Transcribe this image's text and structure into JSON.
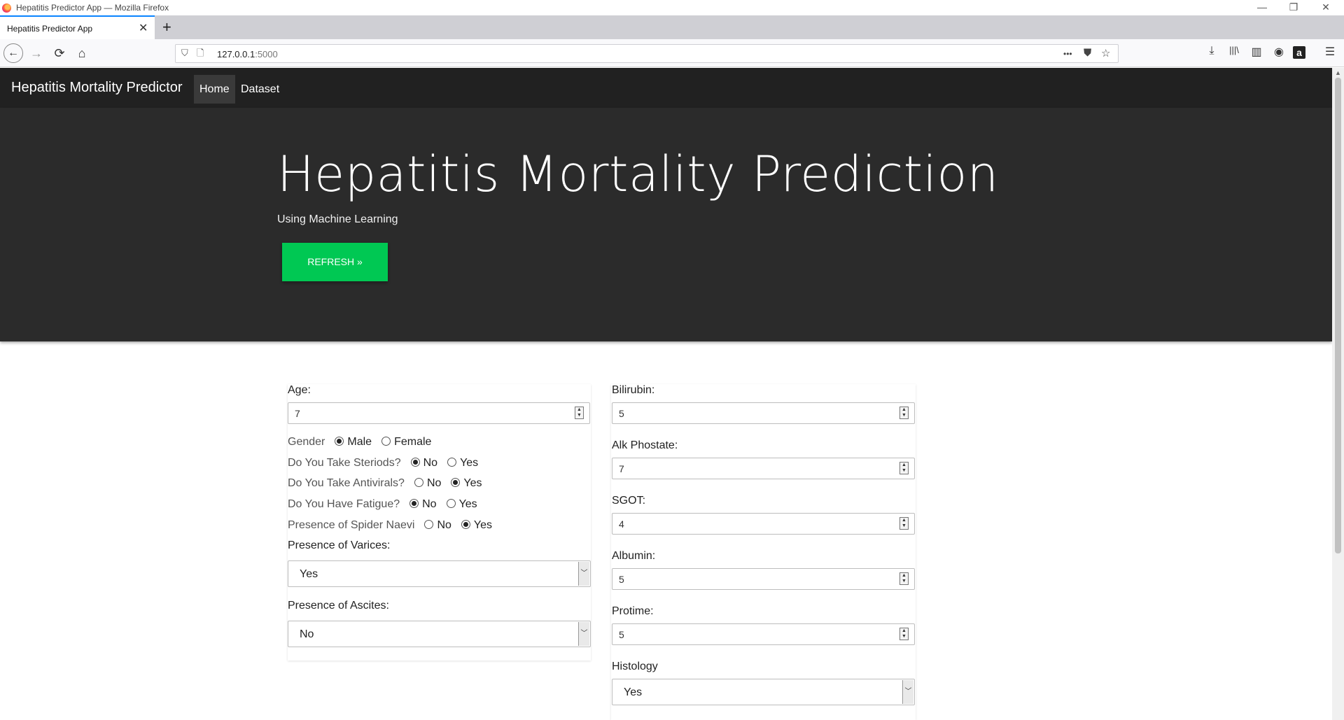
{
  "window": {
    "title": "Hepatitis Predictor App — Mozilla Firefox"
  },
  "tabs": [
    {
      "label": "Hepatitis Predictor App"
    }
  ],
  "address_bar": {
    "host": "127.0.0.1",
    "port": ":5000"
  },
  "site_nav": {
    "brand": "Hepatitis Mortality Predictor",
    "links": [
      {
        "label": "Home",
        "active": true
      },
      {
        "label": "Dataset",
        "active": false
      }
    ]
  },
  "hero": {
    "title": "Hepatitis Mortality Prediction",
    "subtitle": "Using Machine Learning",
    "button_label": "REFRESH »"
  },
  "form_left": {
    "age_label": "Age:",
    "age_value": "7",
    "gender": {
      "question": "Gender",
      "options": [
        "Male",
        "Female"
      ],
      "selected": "Male"
    },
    "steroids": {
      "question": "Do You Take Steriods?",
      "options": [
        "No",
        "Yes"
      ],
      "selected": "No"
    },
    "antivirals": {
      "question": "Do You Take Antivirals?",
      "options": [
        "No",
        "Yes"
      ],
      "selected": "Yes"
    },
    "fatigue": {
      "question": "Do You Have Fatigue?",
      "options": [
        "No",
        "Yes"
      ],
      "selected": "No"
    },
    "spider_naevi": {
      "question": "Presence of Spider Naevi",
      "options": [
        "No",
        "Yes"
      ],
      "selected": "Yes"
    },
    "varices_label": "Presence of Varices:",
    "varices_value": "Yes",
    "ascites_label": "Presence of Ascites:",
    "ascites_value": "No"
  },
  "form_right": {
    "bilirubin_label": "Bilirubin:",
    "bilirubin_value": "5",
    "alk_label": "Alk Phostate:",
    "alk_value": "7",
    "sgot_label": "SGOT:",
    "sgot_value": "4",
    "albumin_label": "Albumin:",
    "albumin_value": "5",
    "protime_label": "Protime:",
    "protime_value": "5",
    "histology_label": "Histology",
    "histology_value": "Yes"
  },
  "icons": {
    "back": "←",
    "forward": "→",
    "reload": "⟳",
    "home": "⌂",
    "shield": "⛉",
    "page": "🗋",
    "more": "•••",
    "pocket": "⛊",
    "star": "☆",
    "download": "⤓",
    "library": "|||\\",
    "sidebar": "▥",
    "account": "◉",
    "amazon": "a",
    "menu": "☰",
    "close": "✕",
    "plus": "+",
    "minimize": "—",
    "restore": "❐",
    "window_close": "✕"
  }
}
